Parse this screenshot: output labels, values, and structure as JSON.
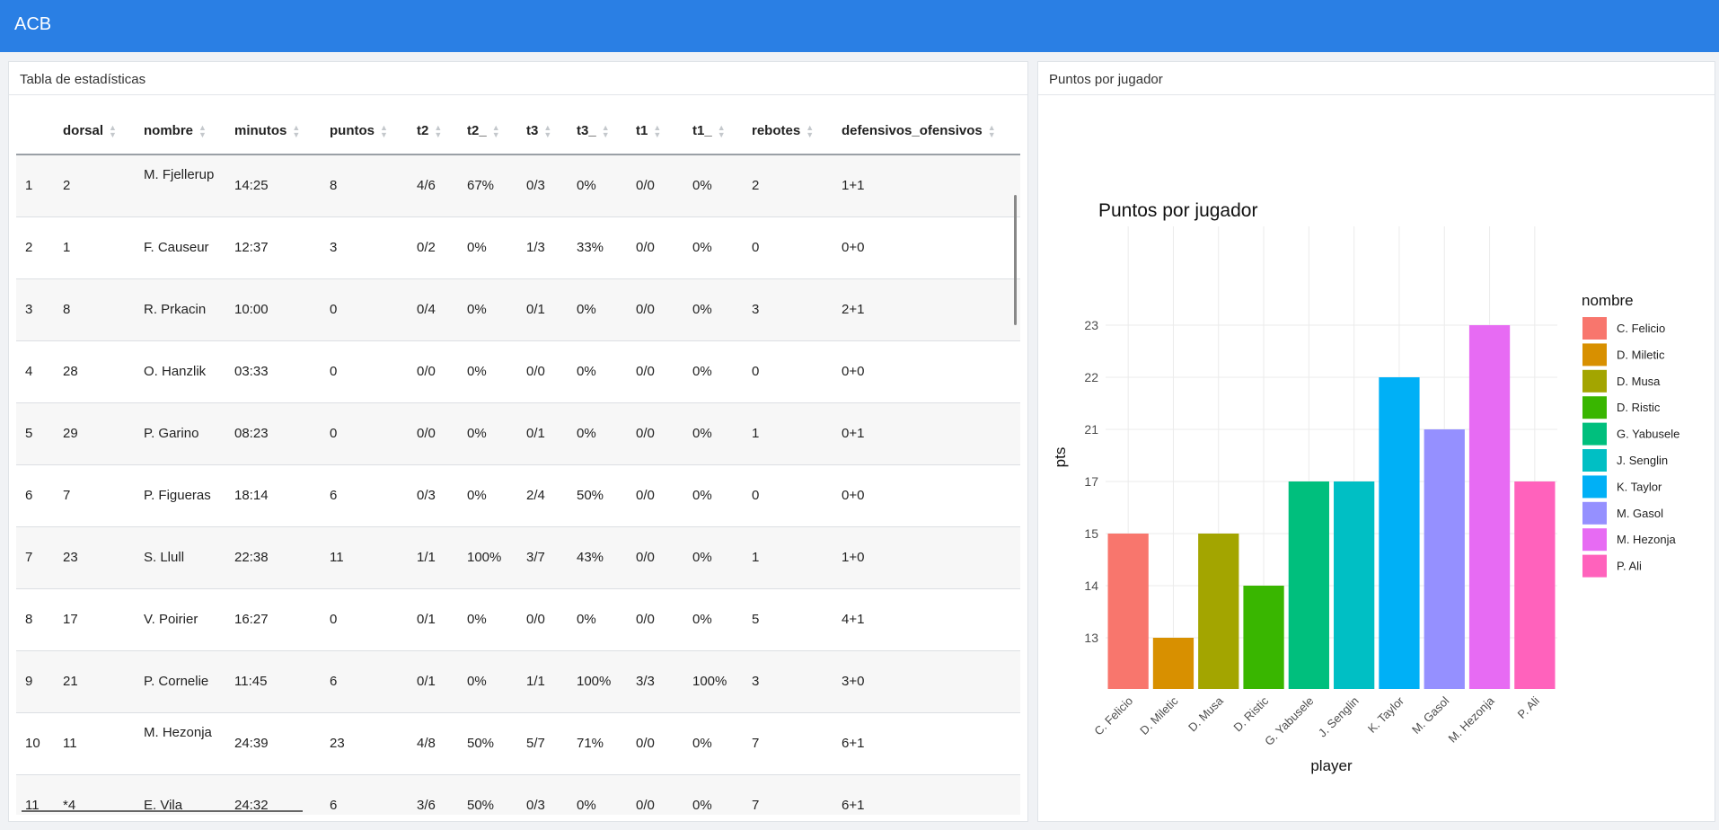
{
  "app": {
    "title": "ACB"
  },
  "table_panel": {
    "title": "Tabla de estadísticas",
    "columns": [
      "",
      "dorsal",
      "nombre",
      "minutos",
      "puntos",
      "t2",
      "t2_",
      "t3",
      "t3_",
      "t1",
      "t1_",
      "rebotes",
      "defensivos_ofensivos"
    ],
    "rows": [
      [
        "1",
        "2",
        "M. Fjellerup",
        "14:25",
        "8",
        "4/6",
        "67%",
        "0/3",
        "0%",
        "0/0",
        "0%",
        "2",
        "1+1"
      ],
      [
        "2",
        "1",
        "F. Causeur",
        "12:37",
        "3",
        "0/2",
        "0%",
        "1/3",
        "33%",
        "0/0",
        "0%",
        "0",
        "0+0"
      ],
      [
        "3",
        "8",
        "R. Prkacin",
        "10:00",
        "0",
        "0/4",
        "0%",
        "0/1",
        "0%",
        "0/0",
        "0%",
        "3",
        "2+1"
      ],
      [
        "4",
        "28",
        "O. Hanzlik",
        "03:33",
        "0",
        "0/0",
        "0%",
        "0/0",
        "0%",
        "0/0",
        "0%",
        "0",
        "0+0"
      ],
      [
        "5",
        "29",
        "P. Garino",
        "08:23",
        "0",
        "0/0",
        "0%",
        "0/1",
        "0%",
        "0/0",
        "0%",
        "1",
        "0+1"
      ],
      [
        "6",
        "7",
        "P. Figueras",
        "18:14",
        "6",
        "0/3",
        "0%",
        "2/4",
        "50%",
        "0/0",
        "0%",
        "0",
        "0+0"
      ],
      [
        "7",
        "23",
        "S. Llull",
        "22:38",
        "11",
        "1/1",
        "100%",
        "3/7",
        "43%",
        "0/0",
        "0%",
        "1",
        "1+0"
      ],
      [
        "8",
        "17",
        "V. Poirier",
        "16:27",
        "0",
        "0/1",
        "0%",
        "0/0",
        "0%",
        "0/0",
        "0%",
        "5",
        "4+1"
      ],
      [
        "9",
        "21",
        "P. Cornelie",
        "11:45",
        "6",
        "0/1",
        "0%",
        "1/1",
        "100%",
        "3/3",
        "100%",
        "3",
        "3+0"
      ],
      [
        "10",
        "11",
        "M. Hezonja",
        "24:39",
        "23",
        "4/8",
        "50%",
        "5/7",
        "71%",
        "0/0",
        "0%",
        "7",
        "6+1"
      ],
      [
        "11",
        "*4",
        "E. Vila",
        "24:32",
        "6",
        "3/6",
        "50%",
        "0/3",
        "0%",
        "0/0",
        "0%",
        "7",
        "6+1"
      ]
    ]
  },
  "chart_panel": {
    "title": "Puntos por jugador"
  },
  "chart_data": {
    "type": "bar",
    "title": "Puntos por jugador",
    "xlabel": "player",
    "ylabel": "pts",
    "categories": [
      "C. Felicio",
      "D. Miletic",
      "D. Musa",
      "D. Ristic",
      "G. Yabusele",
      "J. Senglin",
      "K. Taylor",
      "M. Gasol",
      "M. Hezonja",
      "P. Ali"
    ],
    "values": [
      15,
      13,
      15,
      14,
      17,
      17,
      22,
      21,
      23,
      17
    ],
    "y_ticks": [
      "13",
      "14",
      "15",
      "17",
      "21",
      "22",
      "23"
    ],
    "legend_title": "nombre",
    "legend_placement": "right",
    "colors": [
      "#F8766D",
      "#D89000",
      "#A3A500",
      "#39B600",
      "#00BF7D",
      "#00BFC4",
      "#00B0F6",
      "#9590FF",
      "#E76BF3",
      "#FF62BC"
    ],
    "grid": true
  }
}
